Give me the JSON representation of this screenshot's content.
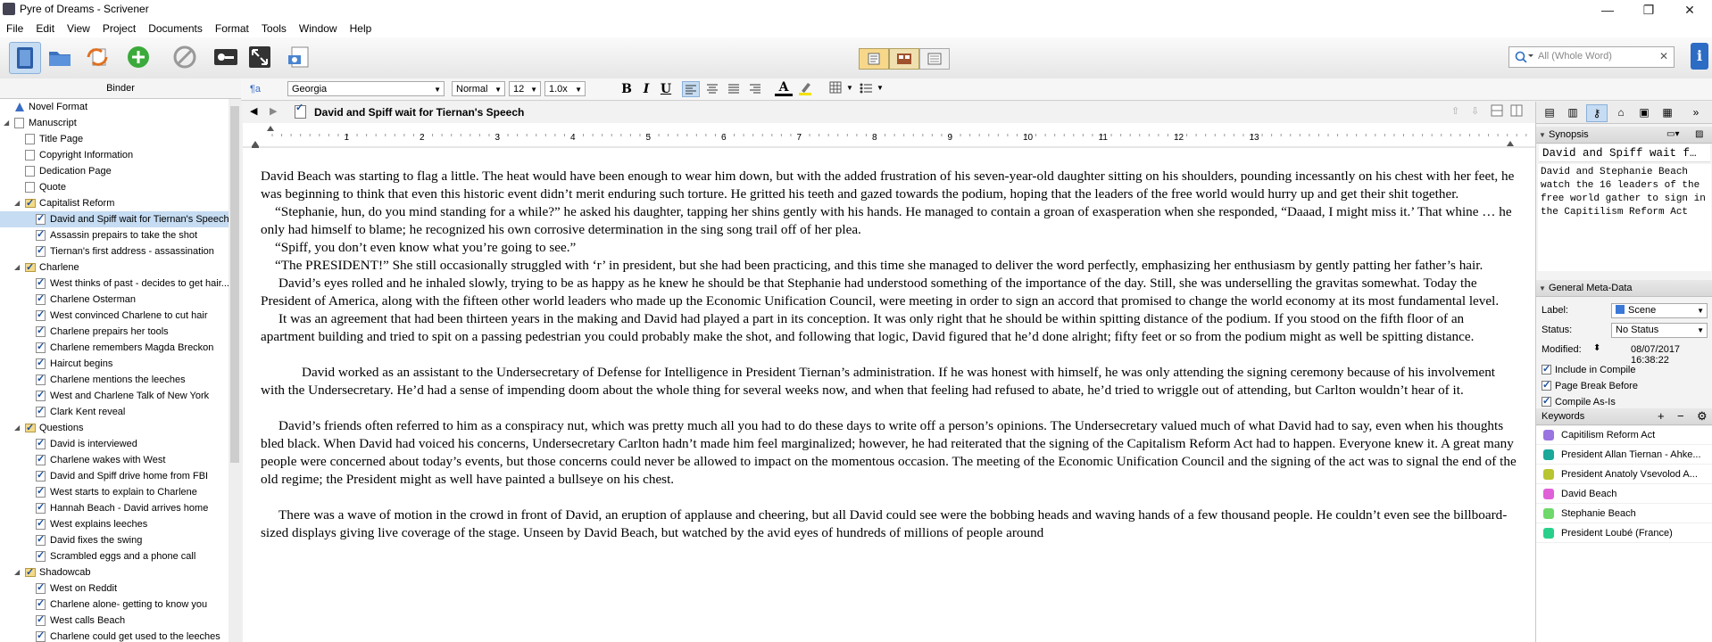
{
  "window": {
    "title": "Pyre of Dreams - Scrivener",
    "controls": {
      "minimize": "—",
      "restore": "❐",
      "close": "✕"
    }
  },
  "menu": [
    "File",
    "Edit",
    "View",
    "Project",
    "Documents",
    "Format",
    "Tools",
    "Window",
    "Help"
  ],
  "search": {
    "placeholder": "All (Whole Word)"
  },
  "binder": {
    "header": "Binder",
    "items": [
      {
        "label": "Novel Format",
        "level": 0,
        "kind": "novel"
      },
      {
        "label": "Manuscript",
        "level": 0,
        "kind": "folder-doc",
        "expanded": true
      },
      {
        "label": "Title Page",
        "level": 1,
        "kind": "doc"
      },
      {
        "label": "Copyright Information",
        "level": 1,
        "kind": "doc"
      },
      {
        "label": "Dedication Page",
        "level": 1,
        "kind": "doc"
      },
      {
        "label": "Quote",
        "level": 1,
        "kind": "doc"
      },
      {
        "label": "Capitalist Reform",
        "level": 1,
        "kind": "folder",
        "expanded": true
      },
      {
        "label": "David and Spiff wait for Tiernan's Speech",
        "level": 2,
        "kind": "checked",
        "selected": true
      },
      {
        "label": "Assassin prepairs to take the shot",
        "level": 2,
        "kind": "checked"
      },
      {
        "label": "Tiernan's first address - assassination",
        "level": 2,
        "kind": "checked"
      },
      {
        "label": "Charlene",
        "level": 1,
        "kind": "folder",
        "expanded": true
      },
      {
        "label": "West thinks of past - decides to get hair...",
        "level": 2,
        "kind": "checked"
      },
      {
        "label": "Charlene Osterman",
        "level": 2,
        "kind": "checked"
      },
      {
        "label": "West convinced Charlene to cut hair",
        "level": 2,
        "kind": "checked"
      },
      {
        "label": "Charlene prepairs her tools",
        "level": 2,
        "kind": "checked"
      },
      {
        "label": "Charlene remembers Magda Breckon",
        "level": 2,
        "kind": "checked"
      },
      {
        "label": "Haircut begins",
        "level": 2,
        "kind": "checked"
      },
      {
        "label": "Charlene mentions the leeches",
        "level": 2,
        "kind": "checked"
      },
      {
        "label": "West and Charlene Talk of New York",
        "level": 2,
        "kind": "checked"
      },
      {
        "label": "Clark Kent reveal",
        "level": 2,
        "kind": "checked"
      },
      {
        "label": "Questions",
        "level": 1,
        "kind": "folder",
        "expanded": true
      },
      {
        "label": "David is interviewed",
        "level": 2,
        "kind": "checked"
      },
      {
        "label": "Charlene wakes with West",
        "level": 2,
        "kind": "checked"
      },
      {
        "label": "David and Spiff drive home from FBI",
        "level": 2,
        "kind": "checked"
      },
      {
        "label": "West starts to explain to Charlene",
        "level": 2,
        "kind": "checked"
      },
      {
        "label": "Hannah Beach - David arrives home",
        "level": 2,
        "kind": "checked"
      },
      {
        "label": "West explains leeches",
        "level": 2,
        "kind": "checked"
      },
      {
        "label": "David fixes the swing",
        "level": 2,
        "kind": "checked"
      },
      {
        "label": "Scrambled eggs and a phone call",
        "level": 2,
        "kind": "checked"
      },
      {
        "label": "Shadowcab",
        "level": 1,
        "kind": "folder",
        "expanded": true
      },
      {
        "label": "West on Reddit",
        "level": 2,
        "kind": "checked"
      },
      {
        "label": "Charlene alone- getting to know you",
        "level": 2,
        "kind": "checked"
      },
      {
        "label": "West calls Beach",
        "level": 2,
        "kind": "checked"
      },
      {
        "label": "Charlene could get used to the leeches",
        "level": 2,
        "kind": "checked"
      }
    ]
  },
  "format": {
    "font": "Georgia",
    "style": "Normal",
    "size": "12",
    "spacing": "1.0x",
    "bold": "B",
    "italic": "I",
    "underline": "U"
  },
  "editor": {
    "doc_title": "David and Spiff wait for Tiernan's Speech",
    "ruler_numbers": [
      "1",
      "2",
      "3",
      "4",
      "5",
      "6",
      "7",
      "8",
      "9",
      "10",
      "11",
      "12",
      "13"
    ],
    "paragraphs": [
      "David Beach was starting to flag a little. The heat would have been enough to wear him down, but with the added frustration of his seven-year-old daughter sitting on his shoulders, pounding incessantly on his chest with her feet, he was beginning to think that even this historic event didn’t merit enduring such torture. He gritted his teeth and gazed towards the podium, hoping that the leaders of the free world would hurry up and get their shit together.",
      "“Stephanie, hun, do you mind standing for a while?” he asked his daughter, tapping her shins gently with his hands. He managed to contain a groan of exasperation when she responded, “Daaad, I might miss it.’ That whine … he only had himself to blame; he recognized his own corrosive determination in the sing song trail off of her plea.",
      "“Spiff, you don’t even know what you’re going to see.”",
      "“The PRESIDENT!” She still occasionally struggled with ‘r’ in president, but she had been practicing, and this time she managed to deliver the word perfectly, emphasizing her enthusiasm by gently patting her father’s hair.",
      "David’s eyes rolled and he inhaled slowly, trying to be as happy as he knew he should be that Stephanie had understood something of the importance of the day. Still, she was underselling the gravitas somewhat. Today the President of America, along with the fifteen other world leaders who made up the Economic Unification Council, were meeting in order to sign an accord that promised to change the world economy at its most fundamental level.",
      "It was an agreement that had been thirteen years in the making and David had played a part in its conception. It was only right that he should be within spitting distance of the podium. If you stood on the fifth floor of an apartment building and tried to spit on a passing pedestrian you could probably make the shot, and following that logic, David figured that he’d done alright; fifty feet or so from the podium might as well be spitting distance.",
      "",
      "David worked as an assistant to the Undersecretary of Defense for Intelligence in President Tiernan’s administration. If he was honest with himself, he was only attending the signing ceremony because of his involvement with the Undersecretary. He’d had a sense of impending doom about the whole thing for several weeks now, and when that feeling had refused to abate, he’d tried to wriggle out of attending, but Carlton wouldn’t hear of it.",
      "",
      "David’s friends often referred to him as a conspiracy nut, which was pretty much all you had to do these days to write off a person’s opinions. The Undersecretary valued much of what David had to say, even when his thoughts bled black. When David had voiced his concerns, Undersecretary Carlton hadn’t made him feel marginalized; however, he had reiterated that the signing of the Capitalism Reform Act had to happen. Everyone knew it. A great many people were concerned about today’s events, but those concerns could never be allowed to impact on the momentous occasion. The meeting of the Economic Unification Council and the signing of the act was to signal the end of the old regime; the President might as well have painted a bullseye on his chest.",
      "",
      "There was a wave of motion in the crowd in front of David, an eruption of applause and cheering, but all David could see were the bobbing heads and waving hands of a few thousand people. He couldn’t even see the billboard-sized displays giving live coverage of the stage. Unseen by David Beach, but watched by the avid eyes of hundreds of millions of people around"
    ]
  },
  "inspector": {
    "synopsis_header": "Synopsis",
    "synopsis_title": "David and Spiff wait f…",
    "synopsis_text": "David and Stephanie Beach watch the 16 leaders of the free world gather to sign in the Capitilism Reform Act",
    "meta_header": "General Meta-Data",
    "label_caption": "Label:",
    "label_value": "Scene",
    "label_color": "#3a78d8",
    "status_caption": "Status:",
    "status_value": "No Status",
    "modified_caption": "Modified:",
    "modified_value": "08/07/2017 16:38:22",
    "checks": [
      {
        "label": "Include in Compile",
        "on": true
      },
      {
        "label": "Page Break Before",
        "on": true
      },
      {
        "label": "Compile As-Is",
        "on": true
      }
    ],
    "keywords_header": "Keywords",
    "keywords": [
      {
        "label": "Capitilism Reform Act",
        "color": "#9a74e0"
      },
      {
        "label": "President Allan Tiernan - Ahke...",
        "color": "#1aa89a"
      },
      {
        "label": "President Anatoly Vsevolod A...",
        "color": "#b8c430"
      },
      {
        "label": "David Beach",
        "color": "#e060d8"
      },
      {
        "label": "Stephanie Beach",
        "color": "#6ed86a"
      },
      {
        "label": "President Loubé (France)",
        "color": "#28d08a"
      }
    ]
  }
}
